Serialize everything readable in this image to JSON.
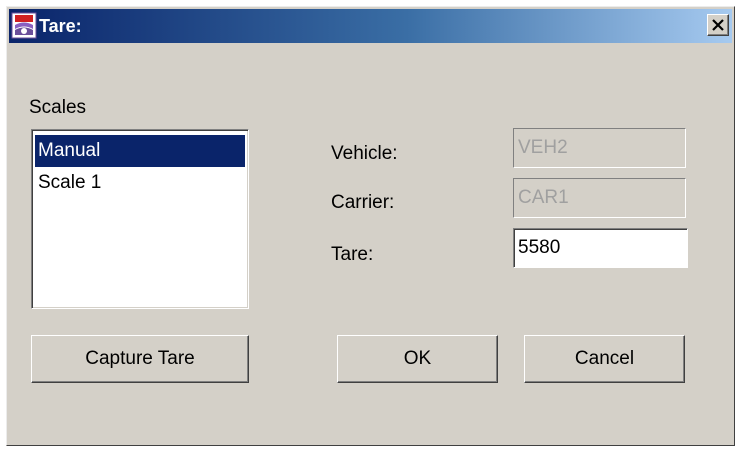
{
  "window": {
    "title": "Tare:",
    "icon": "scale-app-icon",
    "close_icon": "close-icon"
  },
  "scales": {
    "label": "Scales",
    "items": [
      {
        "label": "Manual",
        "selected": true
      },
      {
        "label": "Scale 1",
        "selected": false
      }
    ]
  },
  "form": {
    "vehicle": {
      "label": "Vehicle:",
      "value": "VEH2",
      "enabled": false
    },
    "carrier": {
      "label": "Carrier:",
      "value": "CAR1",
      "enabled": false
    },
    "tare": {
      "label": "Tare:",
      "value": "5580",
      "enabled": true
    }
  },
  "buttons": {
    "capture": "Capture Tare",
    "ok": "OK",
    "cancel": "Cancel"
  },
  "colors": {
    "titlebar_start": "#0a246a",
    "titlebar_end": "#a6caf0",
    "selection": "#0a246a",
    "dialog_bg": "#d4d0c8"
  }
}
